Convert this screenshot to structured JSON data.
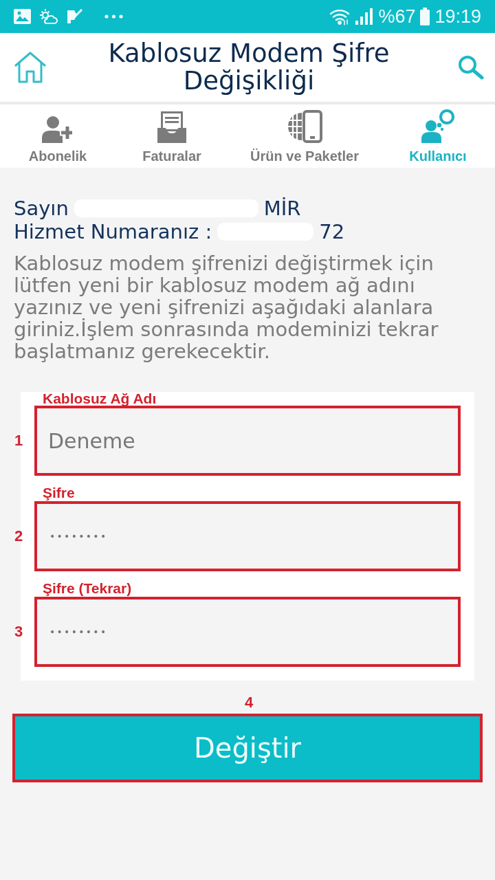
{
  "status_bar": {
    "battery": "%67",
    "time": "19:19"
  },
  "header": {
    "title": "Kablosuz Modem Şifre Değişikliği"
  },
  "tabs": [
    {
      "label": "Abonelik",
      "selected": false
    },
    {
      "label": "Faturalar",
      "selected": false
    },
    {
      "label": "Ürün ve Paketler",
      "selected": false
    },
    {
      "label": "Kullanıcı",
      "selected": true
    }
  ],
  "greeting": {
    "salutation": "Sayın",
    "name_visible": "MİR",
    "service_label": "Hizmet Numaranız :",
    "service_number_visible": "72"
  },
  "description": "Kablosuz modem şifrenizi değiştirmek için lütfen yeni bir kablosuz modem ağ adını yazınız ve yeni şifrenizi aşağıdaki alanlara giriniz.İşlem sonrasında modeminizi tekrar başlatmanız gerekecektir.",
  "form": {
    "fields": [
      {
        "marker": "1",
        "label": "Kablosuz Ağ Adı",
        "kind": "text",
        "value": "Deneme"
      },
      {
        "marker": "2",
        "label": "Şifre",
        "kind": "password",
        "value": "••••••••"
      },
      {
        "marker": "3",
        "label": "Şifre (Tekrar)",
        "kind": "password",
        "value": "••••••••"
      }
    ]
  },
  "submit": {
    "marker": "4",
    "label": "Değiştir"
  }
}
